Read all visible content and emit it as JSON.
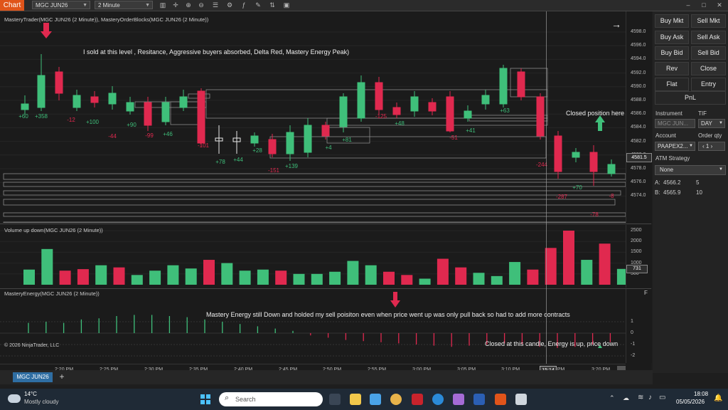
{
  "toolbar": {
    "chart_tab": "Chart",
    "instrument": "MGC JUN26",
    "interval": "2 Minute"
  },
  "panels": {
    "price_title": "MasteryTrader(MGC JUN26 (2 Minute)), MasteryOrderBlocks(MGC JUN26 (2 Minute))",
    "volume_title": "Volume up down(MGC JUN26 (2 Minute))",
    "energy_title": "MasteryEnergy(MGC JUN26 (2 Minute))",
    "copyright": "© 2026 NinjaTrader, LLC",
    "f_marker": "F"
  },
  "annotations": {
    "sold": "I sold at this level , Resitance, Aggressive buyers absorbed, Delta Red, Mastery Energy Peak)",
    "closed_position": "Closed position here",
    "energy_note": "Mastery Energy still Down and holded my sell poisiton even when price went up was only pull back so had to add more contracts",
    "closed_candle": "Closed at this candle, Energy is up, price down"
  },
  "price_axis": {
    "labels": [
      "4598.0",
      "4596.0",
      "4594.0",
      "4592.0",
      "4590.0",
      "4588.0",
      "4586.0",
      "4584.0",
      "4582.0",
      "4580.0",
      "4578.0",
      "4576.0",
      "4574.0"
    ],
    "current_price": "4581.5"
  },
  "volume_axis": {
    "labels": [
      "2500",
      "2000",
      "1500",
      "1000",
      "500"
    ],
    "current": "731"
  },
  "energy_axis": {
    "labels": [
      "1",
      "0",
      "-1",
      "-2"
    ]
  },
  "time_axis": {
    "labels": [
      "2:20 PM",
      "2:25 PM",
      "2:30 PM",
      "2:35 PM",
      "2:40 PM",
      "2:45 PM",
      "2:50 PM",
      "2:55 PM",
      "3:00 PM",
      "3:05 PM",
      "3:10 PM",
      "PM",
      "3:20 PM"
    ],
    "cursor": "15:14"
  },
  "volume_bars": [
    {
      "v": 700,
      "c": "g"
    },
    {
      "v": 1650,
      "c": "g"
    },
    {
      "v": 650,
      "c": "r"
    },
    {
      "v": 720,
      "c": "r"
    },
    {
      "v": 900,
      "c": "g"
    },
    {
      "v": 800,
      "c": "r"
    },
    {
      "v": 450,
      "c": "g"
    },
    {
      "v": 650,
      "c": "g"
    },
    {
      "v": 900,
      "c": "g"
    },
    {
      "v": 750,
      "c": "g"
    },
    {
      "v": 1150,
      "c": "r"
    },
    {
      "v": 1000,
      "c": "g"
    },
    {
      "v": 650,
      "c": "g"
    },
    {
      "v": 700,
      "c": "g"
    },
    {
      "v": 650,
      "c": "r"
    },
    {
      "v": 500,
      "c": "g"
    },
    {
      "v": 500,
      "c": "g"
    },
    {
      "v": 600,
      "c": "g"
    },
    {
      "v": 1100,
      "c": "g"
    },
    {
      "v": 900,
      "c": "g"
    },
    {
      "v": 600,
      "c": "r"
    },
    {
      "v": 450,
      "c": "r"
    },
    {
      "v": 280,
      "c": "g"
    },
    {
      "v": 1200,
      "c": "r"
    },
    {
      "v": 800,
      "c": "r"
    },
    {
      "v": 550,
      "c": "g"
    },
    {
      "v": 400,
      "c": "g"
    },
    {
      "v": 1050,
      "c": "g"
    },
    {
      "v": 700,
      "c": "r"
    },
    {
      "v": 1700,
      "c": "r"
    },
    {
      "v": 2500,
      "c": "r"
    },
    {
      "v": 1150,
      "c": "g"
    },
    {
      "v": 1900,
      "c": "r"
    },
    {
      "v": 731,
      "c": "g"
    }
  ],
  "right_panel": {
    "buy_mkt": "Buy Mkt",
    "sell_mkt": "Sell Mkt",
    "buy_ask": "Buy Ask",
    "sell_ask": "Sell Ask",
    "buy_bid": "Buy Bid",
    "sell_bid": "Sell Bid",
    "rev": "Rev",
    "close": "Close",
    "flat": "Flat",
    "entry": "Entry",
    "pnl": "PnL",
    "instrument_label": "Instrument",
    "instrument_value": "MGC JUN...",
    "tif_label": "TIF",
    "tif_value": "DAY",
    "account_label": "Account",
    "account_value": "PAAPEX2...",
    "order_qty_label": "Order qty",
    "order_qty_value": "1",
    "atm_label": "ATM Strategy",
    "atm_value": "None",
    "ask_label": "A:",
    "ask_price": "4566.2",
    "ask_size": "5",
    "bid_label": "B:",
    "bid_price": "4565.9",
    "bid_size": "10"
  },
  "bottom_tab": "MGC JUN26",
  "taskbar": {
    "temperature": "14°C",
    "weather": "Mostly cloudy",
    "search_placeholder": "Search",
    "time": "18:08",
    "date": "05/05/2026"
  },
  "colors": {
    "up": "#3fbf7a",
    "down": "#e0294f",
    "accent": "#e0541a"
  }
}
